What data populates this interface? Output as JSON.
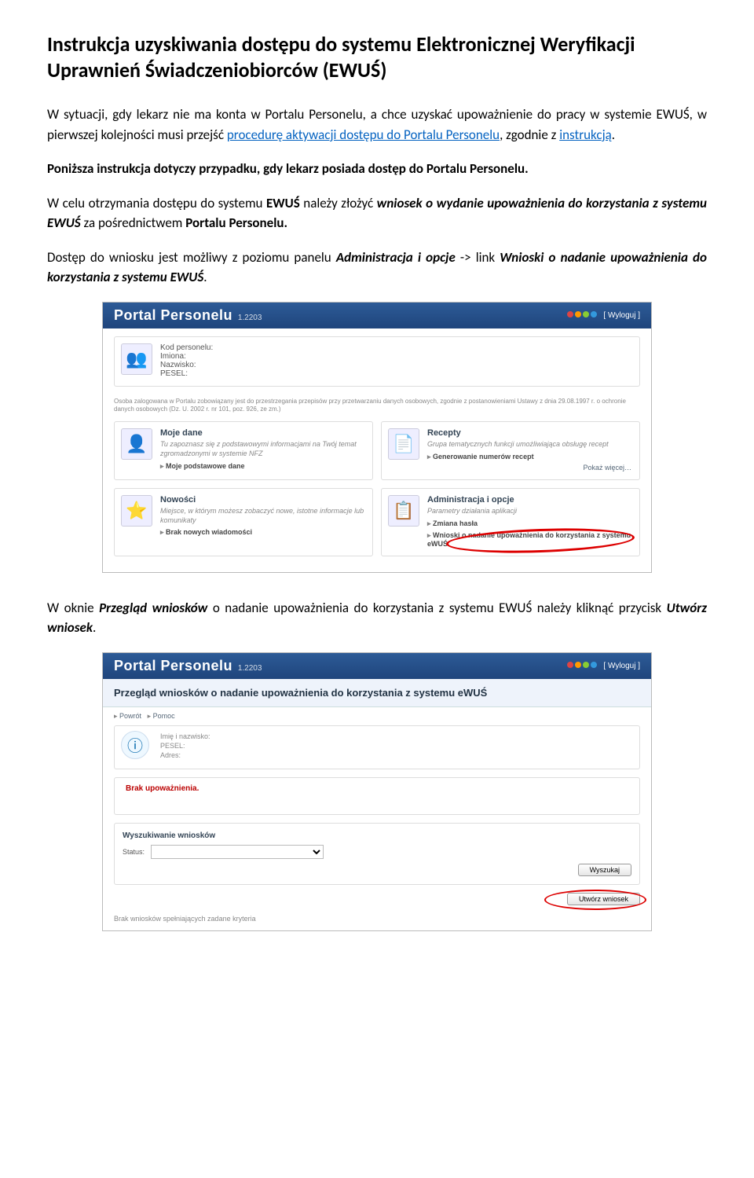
{
  "title": "Instrukcja uzyskiwania dostępu do systemu Elektronicznej Weryfikacji Uprawnień Świadczeniobiorców (EWUŚ)",
  "para1_a": "W sytuacji, gdy lekarz nie ma konta w Portalu Personelu, a chce uzyskać upoważnienie do pracy w systemie EWUŚ, w pierwszej kolejności musi przejść ",
  "link1": "procedurę aktywacji dostępu do Portalu Personelu",
  "para1_b": ", zgodnie z ",
  "link2": "instrukcją",
  "para1_c": ".",
  "para2": "Poniższa instrukcja dotyczy przypadku, gdy lekarz posiada dostęp do Portalu Personelu.",
  "para3_a": "W celu otrzymania dostępu do systemu ",
  "para3_b": "EWUŚ",
  "para3_c": " należy złożyć ",
  "para3_d": "wniosek  o wydanie upoważnienia do korzystania z systemu EWUŚ",
  "para3_e": " za pośrednictwem ",
  "para3_f": "Portalu Personelu.",
  "para4_a": "Dostęp do wniosku jest możliwy z poziomu panelu ",
  "para4_b": "Administracja i opcje",
  "para4_c": " -> link ",
  "para4_d": "Wnioski o nadanie upoważnienia do korzystania z systemu EWUŚ",
  "para4_e": ".",
  "para5_a": "W oknie ",
  "para5_b": "Przegląd wniosków",
  "para5_c": " o nadanie upoważnienia do korzystania z systemu EWUŚ należy kliknąć przycisk ",
  "para5_d": "Utwórz wniosek",
  "para5_e": ".",
  "portal1": {
    "logo": "Portal Personelu",
    "ver": "1.2203",
    "logout": "[ Wyloguj ]",
    "user_labels": {
      "kod": "Kod personelu:",
      "im": "Imiona:",
      "naz": "Nazwisko:",
      "pes": "PESEL:"
    },
    "note": "Osoba zalogowana w Portalu zobowiązany jest do przestrzegania przepisów przy przetwarzaniu danych osobowych, zgodnie z postanowieniami Ustawy z dnia 29.08.1997 r. o ochronie danych osobowych (Dz. U. 2002 r. nr 101, poz. 926, ze zm.)",
    "moje_title": "Moje dane",
    "moje_txt": "Tu zapoznasz się z podstawowymi informacjami na Twój temat zgromadzonymi w systemie NFZ",
    "moje_link": "Moje podstawowe dane",
    "rec_title": "Recepty",
    "rec_txt": "Grupa tematycznych funkcji umożliwiająca obsługę recept",
    "rec_link": "Generowanie numerów recept",
    "rec_more": "Pokaż więcej…",
    "now_title": "Nowości",
    "now_txt": "Miejsce, w którym możesz zobaczyć nowe, istotne informacje lub komunikaty",
    "now_link": "Brak nowych wiadomości",
    "adm_title": "Administracja i opcje",
    "adm_txt": "Parametry działania aplikacji",
    "adm_link1": "Zmiana hasła",
    "adm_link2": "Wnioski o nadanie upoważnienia do korzystania z systemu eWUŚ"
  },
  "portal2": {
    "title": "Przegląd wniosków o nadanie upoważnienia do korzystania z systemu eWUŚ",
    "crumb1": "Powrót",
    "crumb2": "Pomoc",
    "lbl_im": "Imię i nazwisko:",
    "lbl_pes": "PESEL:",
    "lbl_adr": "Adres:",
    "alert": "Brak upoważnienia.",
    "search_title": "Wyszukiwanie wniosków",
    "status_lbl": "Status:",
    "btn_search": "Wyszukaj",
    "btn_create": "Utwórz wniosek",
    "footnote": "Brak wniosków spełniających zadane kryteria"
  }
}
